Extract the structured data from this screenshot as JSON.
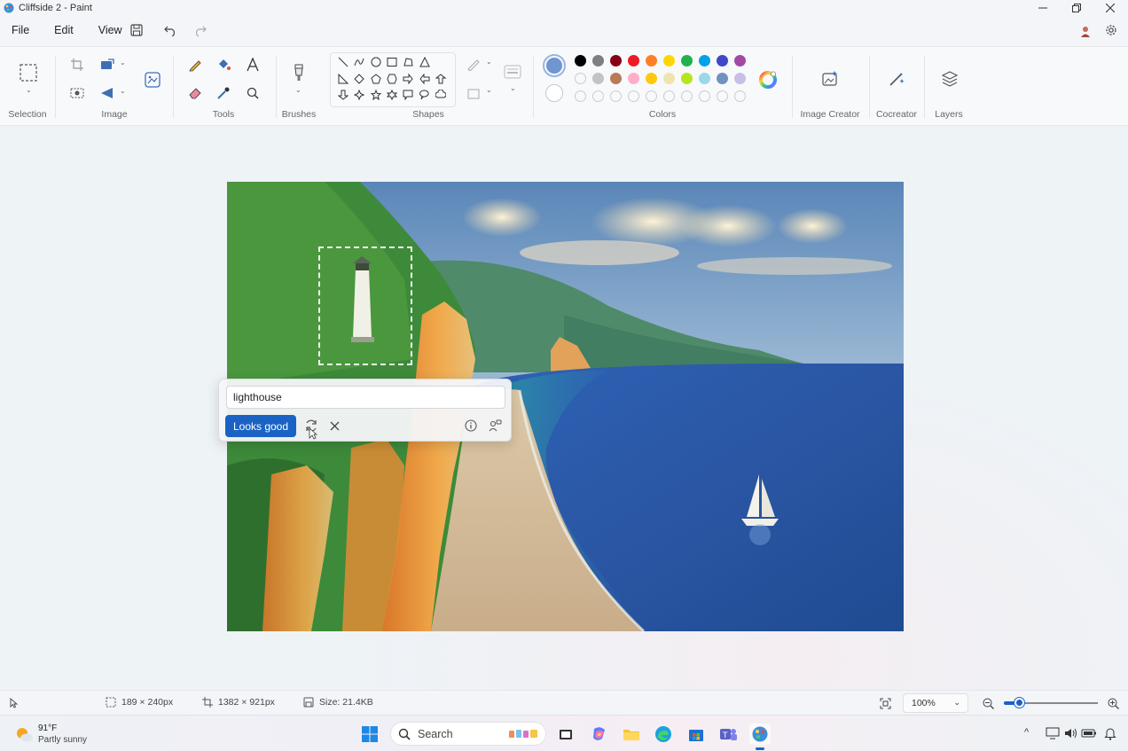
{
  "window": {
    "title": "Cliffside 2 - Paint"
  },
  "menu": {
    "file": "File",
    "edit": "Edit",
    "view": "View"
  },
  "ribbon": {
    "groups": {
      "selection": "Selection",
      "image": "Image",
      "tools": "Tools",
      "brushes": "Brushes",
      "shapes": "Shapes",
      "colors": "Colors",
      "image_creator": "Image Creator",
      "cocreator": "Cocreator",
      "layers": "Layers"
    },
    "colors": {
      "primary": "#7096d1",
      "secondary": "#ffffff",
      "row1": [
        "#000000",
        "#7f7f7f",
        "#880015",
        "#ed1c24",
        "#ff7f27",
        "#ffd700",
        "#22b14c",
        "#00a2e8",
        "#3f48cc",
        "#a349a4"
      ],
      "row2": [
        "empty",
        "#c3c3c3",
        "#b97a57",
        "#ffaec9",
        "#ffc90e",
        "#efe4b0",
        "#b5e61d",
        "#99d9ea",
        "#7092be",
        "#c8bfe7"
      ],
      "row3": [
        "empty",
        "empty",
        "empty",
        "empty",
        "empty",
        "empty",
        "empty",
        "empty",
        "empty",
        "empty"
      ]
    }
  },
  "popup": {
    "prompt_value": "lighthouse",
    "looks_good": "Looks good"
  },
  "status": {
    "selection_size": "189 × 240px",
    "canvas_size": "1382 × 921px",
    "file_size": "Size: 21.4KB",
    "zoom": "100%"
  },
  "taskbar": {
    "temperature": "91°F",
    "weather": "Partly sunny",
    "search_placeholder": "Search"
  },
  "accent": "#1a63c4"
}
